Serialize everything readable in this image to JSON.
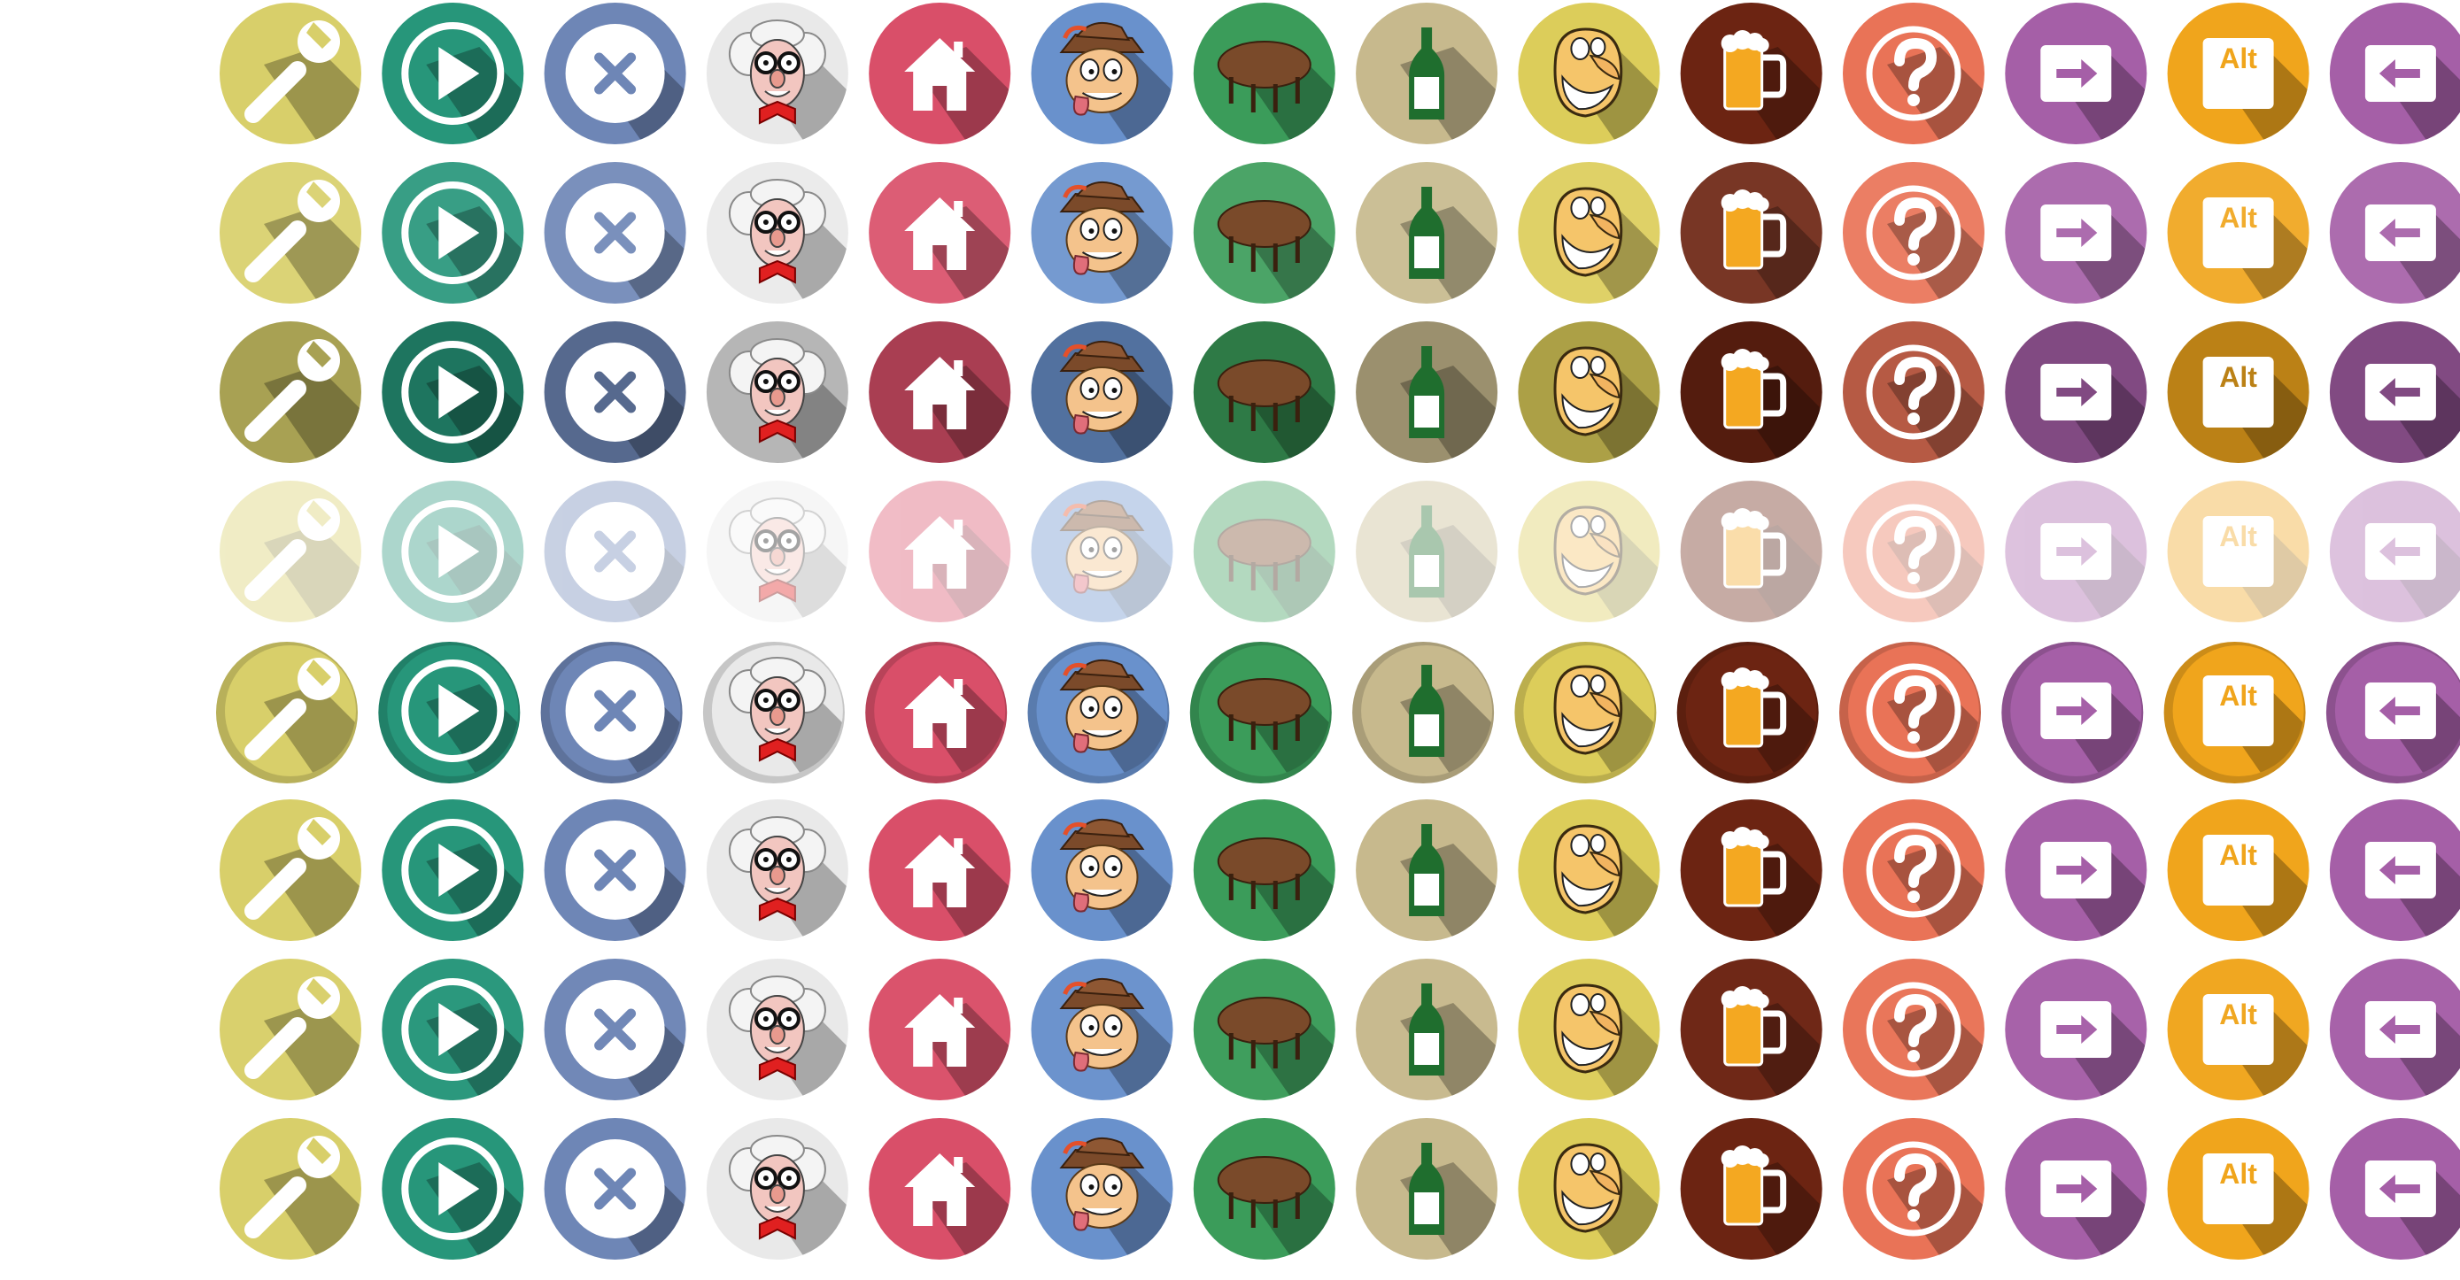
{
  "sheet": {
    "icons": [
      {
        "name": "wrench",
        "color": "#d8cf6a"
      },
      {
        "name": "play",
        "color": "#27967a"
      },
      {
        "name": "close",
        "color": "#6e86b6"
      },
      {
        "name": "professor",
        "color": "#e9e9e9"
      },
      {
        "name": "home",
        "color": "#d94f69"
      },
      {
        "name": "tyrolean",
        "color": "#6991cc"
      },
      {
        "name": "table",
        "color": "#3b9c5a"
      },
      {
        "name": "bottle",
        "color": "#c7b98d"
      },
      {
        "name": "grin",
        "color": "#dccd5a"
      },
      {
        "name": "beer",
        "color": "#6c2412"
      },
      {
        "name": "question",
        "color": "#e97357"
      },
      {
        "name": "arrow-right",
        "color": "#a55fa7"
      },
      {
        "name": "alt-key",
        "color": "#f0a51c"
      },
      {
        "name": "arrow-left",
        "color": "#a55fa7"
      }
    ],
    "alt_label": "Alt",
    "variants": [
      {
        "name": "normal"
      },
      {
        "name": "light"
      },
      {
        "name": "dark"
      },
      {
        "name": "faded"
      },
      {
        "name": "pressed"
      },
      {
        "name": "raised"
      },
      {
        "name": "raised-alt"
      },
      {
        "name": "raised-deep"
      }
    ]
  }
}
